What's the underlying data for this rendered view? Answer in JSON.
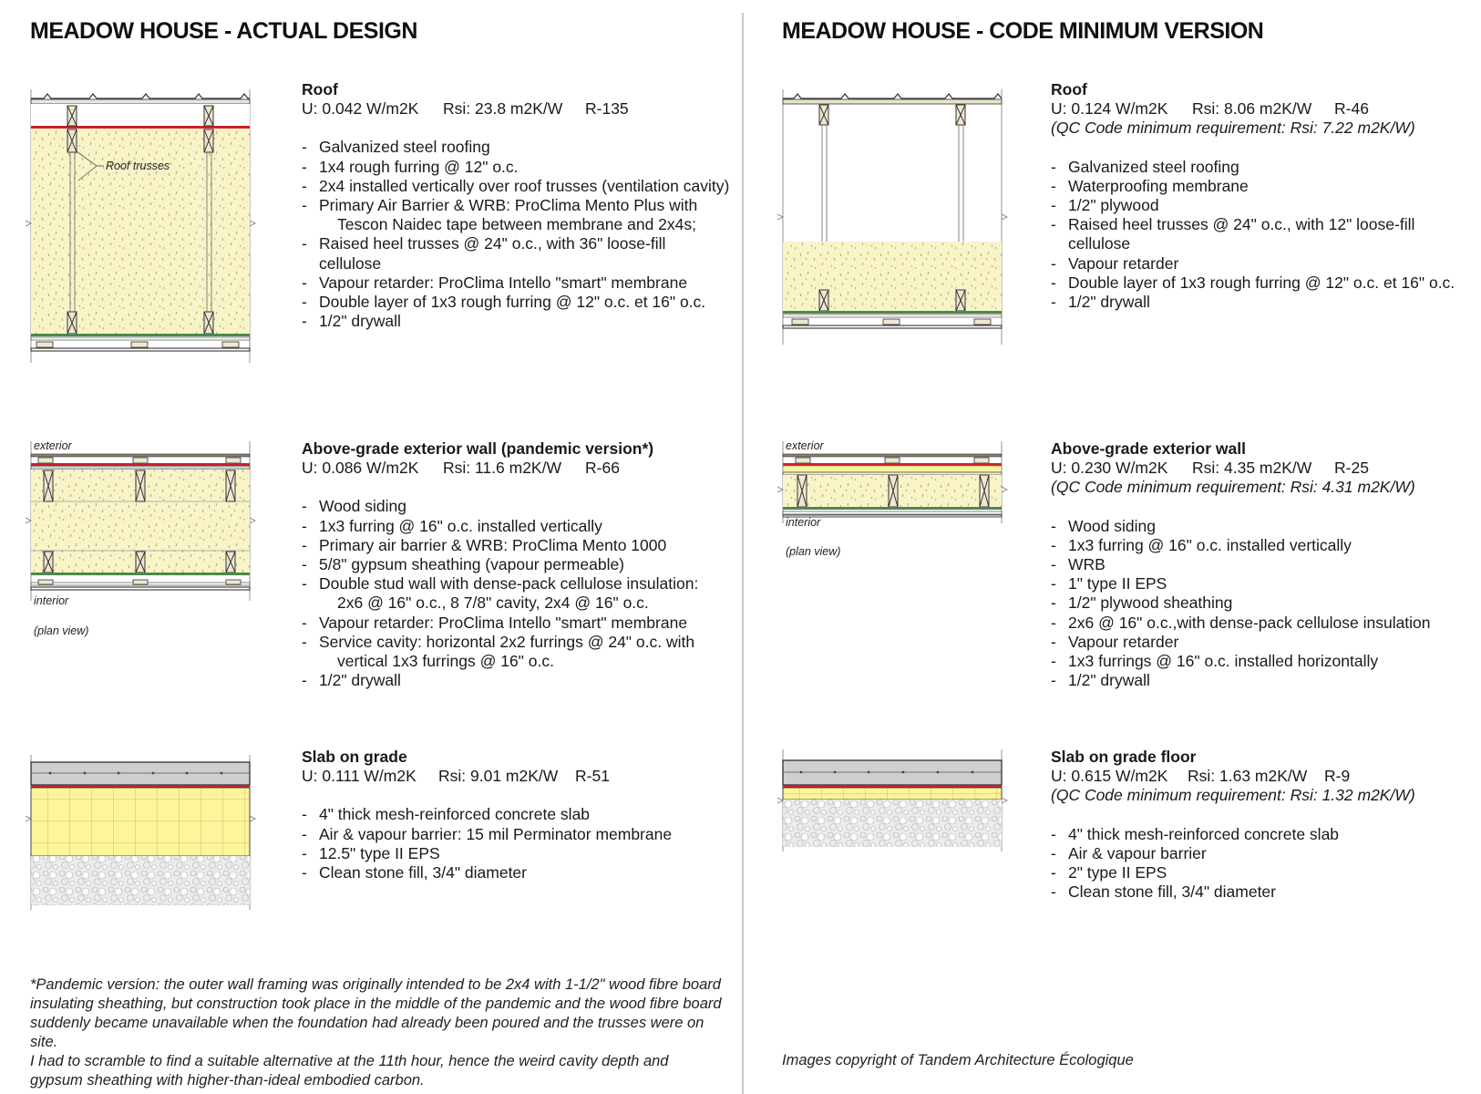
{
  "left": {
    "title": "MEADOW HOUSE - ACTUAL DESIGN",
    "roof": {
      "heading": "Roof",
      "u": "U: 0.042 W/m2K",
      "rsi": "Rsi: 23.8 m2K/W",
      "r": "R-135",
      "diagram_label": "Roof trusses",
      "items": [
        {
          "text": "Galvanized steel roofing"
        },
        {
          "text": "1x4 rough furring @ 12\" o.c."
        },
        {
          "text": "2x4 installed vertically over roof trusses (ventilation cavity)"
        },
        {
          "text": "Primary Air Barrier & WRB: ProClima Mento Plus with",
          "cont": "Tescon Naidec tape between membrane and 2x4s;"
        },
        {
          "text": "Raised heel trusses @ 24\" o.c., with 36\" loose-fill cellulose"
        },
        {
          "text": "Vapour retarder: ProClima Intello \"smart\" membrane"
        },
        {
          "text": "Double layer of 1x3 rough furring @ 12\" o.c. et 16\" o.c."
        },
        {
          "text": "1/2\" drywall"
        }
      ]
    },
    "wall": {
      "heading": "Above-grade exterior wall (pandemic version*)",
      "u": "U: 0.086 W/m2K",
      "rsi": "Rsi: 11.6 m2K/W",
      "r": "R-66",
      "label_exterior": "exterior",
      "label_interior": "interior",
      "label_view": "(plan view)",
      "items": [
        {
          "text": "Wood siding"
        },
        {
          "text": "1x3 furring @ 16\" o.c. installed vertically"
        },
        {
          "text": "Primary air barrier & WRB: ProClima Mento 1000"
        },
        {
          "text": "5/8\" gypsum sheathing (vapour permeable)"
        },
        {
          "text": "Double stud wall with dense-pack cellulose insulation:",
          "cont": "2x6 @ 16\" o.c., 8 7/8\" cavity, 2x4 @ 16\" o.c."
        },
        {
          "text": "Vapour retarder:  ProClima Intello \"smart\" membrane"
        },
        {
          "text": "Service cavity: horizontal 2x2 furrings @ 24\" o.c. with",
          "cont": "vertical 1x3 furrings @ 16\" o.c."
        },
        {
          "text": "1/2\" drywall"
        }
      ]
    },
    "slab": {
      "heading": "Slab on grade",
      "u": "U: 0.111 W/m2K",
      "rsi": "Rsi: 9.01 m2K/W",
      "r": "R-51",
      "items": [
        {
          "text": "4\" thick mesh-reinforced concrete slab"
        },
        {
          "text": "Air & vapour barrier: 15 mil Perminator membrane"
        },
        {
          "text": "12.5\" type II EPS"
        },
        {
          "text": "Clean stone fill, 3/4\" diameter"
        }
      ]
    },
    "footnote": [
      "*Pandemic version: the outer wall framing was originally intended to be 2x4 with 1-1/2\" wood fibre board",
      "insulating sheathing, but construction took place in the middle of the pandemic and the wood fibre board",
      "suddenly became unavailable when the foundation had already been poured and the trusses were on site.",
      "I had to scramble to find a suitable alternative at the 11th hour,  hence the weird cavity depth and",
      "gypsum sheathing with higher-than-ideal embodied carbon."
    ]
  },
  "right": {
    "title": "MEADOW HOUSE - CODE MINIMUM VERSION",
    "roof": {
      "heading": "Roof",
      "u": "U: 0.124 W/m2K",
      "rsi": "Rsi: 8.06 m2K/W",
      "r": "R-46",
      "requirement": "(QC Code minimum requirement:  Rsi: 7.22 m2K/W)",
      "items": [
        {
          "text": "Galvanized steel roofing"
        },
        {
          "text": "Waterproofing membrane"
        },
        {
          "text": "1/2\" plywood"
        },
        {
          "text": "Raised heel trusses @ 24\" o.c., with 12\" loose-fill cellulose"
        },
        {
          "text": "Vapour retarder"
        },
        {
          "text": "Double layer of 1x3 rough furring @ 12\" o.c. et 16\" o.c."
        },
        {
          "text": "1/2\" drywall"
        }
      ]
    },
    "wall": {
      "heading": "Above-grade exterior wall",
      "u": "U: 0.230 W/m2K",
      "rsi": "Rsi: 4.35 m2K/W",
      "r": "R-25",
      "requirement": "(QC Code minimum requirement:  Rsi: 4.31 m2K/W)",
      "label_exterior": "exterior",
      "label_interior": "interior",
      "label_view": "(plan view)",
      "items": [
        {
          "text": "Wood siding"
        },
        {
          "text": "1x3 furring @ 16\" o.c. installed vertically"
        },
        {
          "text": "WRB"
        },
        {
          "text": "1\" type II EPS"
        },
        {
          "text": "1/2\" plywood sheathing"
        },
        {
          "text": "2x6 @ 16\" o.c.,with dense-pack cellulose insulation"
        },
        {
          "text": "Vapour retarder"
        },
        {
          "text": "1x3 furrings @ 16\" o.c. installed horizontally"
        },
        {
          "text": "1/2\" drywall"
        }
      ]
    },
    "slab": {
      "heading": "Slab on grade floor",
      "u": "U: 0.615 W/m2K",
      "rsi": "Rsi: 1.63 m2K/W",
      "r": "R-9",
      "requirement": "(QC Code minimum requirement:  Rsi: 1.32 m2K/W)",
      "items": [
        {
          "text": "4\" thick mesh-reinforced concrete slab"
        },
        {
          "text": "Air & vapour barrier"
        },
        {
          "text": "2\" type II EPS"
        },
        {
          "text": "Clean stone fill, 3/4\" diameter"
        }
      ]
    },
    "copyright": "Images copyright of Tandem Architecture Écologique"
  },
  "colors": {
    "cellulose": "#f8f4c8",
    "eps": "#fdf59a",
    "membrane_red": "#d0202a",
    "vapour_green": "#4a8a4a",
    "concrete": "#cfcfcf",
    "gravel": "#e6e6e6",
    "wood": "#efe7cf",
    "divider": "#c9c9c9"
  }
}
